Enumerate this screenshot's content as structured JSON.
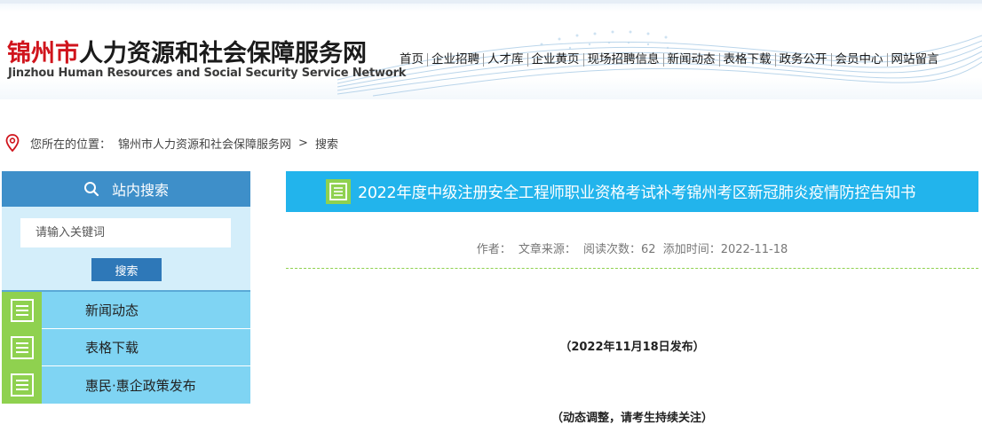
{
  "header": {
    "logo_red": "锦州市",
    "logo_black": "人力资源和社会保障服务网",
    "logo_en": "Jinzhou Human Resources and Social Security Service Network"
  },
  "nav": {
    "items": [
      "首页",
      "企业招聘",
      "人才库",
      "企业黄页",
      "现场招聘信息",
      "新闻动态",
      "表格下载",
      "政务公开",
      "会员中心",
      "网站留言"
    ]
  },
  "breadcrumb": {
    "prefix": "您所在的位置：",
    "site": "锦州市人力资源和社会保障服务网",
    "arrow": ">",
    "current": "搜索"
  },
  "sidebar": {
    "search_title": "站内搜索",
    "search_placeholder": "请输入关键词",
    "search_button": "搜索",
    "menu": [
      "新闻动态",
      "表格下载",
      "惠民·惠企政策发布"
    ]
  },
  "article": {
    "title": "2022年度中级注册安全工程师职业资格考试补考锦州考区新冠肺炎疫情防控告知书",
    "meta": {
      "author": "作者：",
      "source": "文章来源：",
      "reads": "阅读次数：62",
      "added": "添加时间：2022-11-18"
    },
    "para1": "（2022年11月18日发布）",
    "para2": "（动态调整，请考生持续关注）"
  },
  "colors": {
    "accent_blue": "#22b4ec",
    "search_blue": "#3e8fc9",
    "menu_blue": "#7fd4f3",
    "icon_green": "#8fd14f",
    "logo_red": "#d0141c"
  }
}
